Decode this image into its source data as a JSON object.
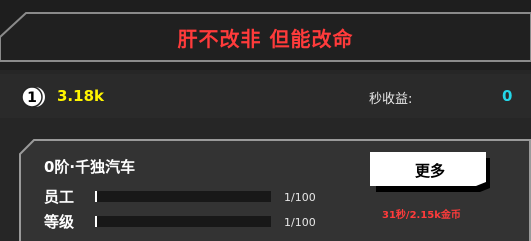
{
  "banner": {
    "slogan": "肝不改非 但能改命"
  },
  "stats": {
    "coin_icon_text": "1",
    "coins": "3.18k",
    "per_second_label": "秒收益:",
    "per_second_value": "0"
  },
  "business": {
    "title": "0阶·千独汽车",
    "employees": {
      "label": "员工",
      "progress": "1/100",
      "fill_ratio": 0.01
    },
    "level": {
      "label": "等级",
      "progress": "1/100",
      "fill_ratio": 0.01
    },
    "more_button": "更多",
    "income_rate": "31秒/2.15k金币"
  },
  "colors": {
    "slogan_red": "#ff3b3b",
    "coin_yellow": "#fff500",
    "per_second_cyan": "#23d7e8"
  }
}
